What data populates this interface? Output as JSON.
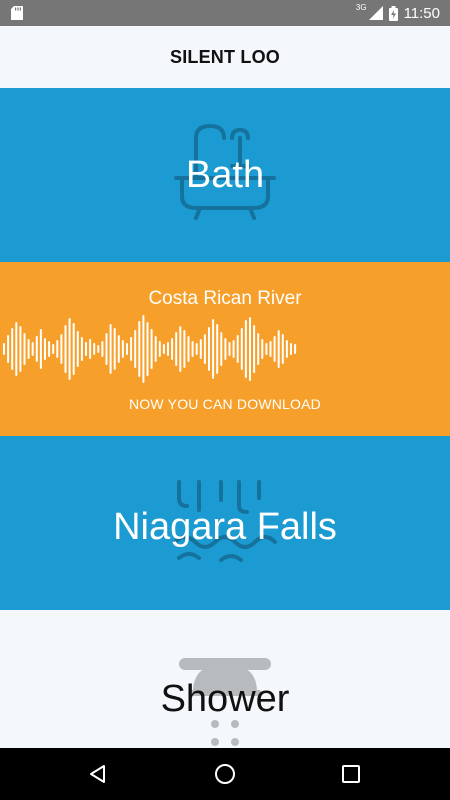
{
  "status_bar": {
    "network": "3G",
    "time": "11:50",
    "icons": [
      "sd-card-icon",
      "signal-icon",
      "battery-charging-icon"
    ]
  },
  "app": {
    "title": "SILENT LOO"
  },
  "sounds": {
    "bath": {
      "label": "Bath",
      "icon": "bathtub-icon"
    },
    "river": {
      "name": "Costa Rican River",
      "subtitle": "NOW YOU CAN DOWNLOAD",
      "icon": "waveform-icon"
    },
    "niagara": {
      "label": "Niagara Falls",
      "icon": "waterfall-icon"
    },
    "shower": {
      "label": "Shower",
      "icon": "shower-head-icon"
    }
  },
  "colors": {
    "blue": "#1b9bd1",
    "orange": "#f6a02b",
    "light": "#f4f7fb"
  },
  "nav": {
    "icons": [
      "back-icon",
      "home-icon",
      "recents-icon"
    ]
  }
}
